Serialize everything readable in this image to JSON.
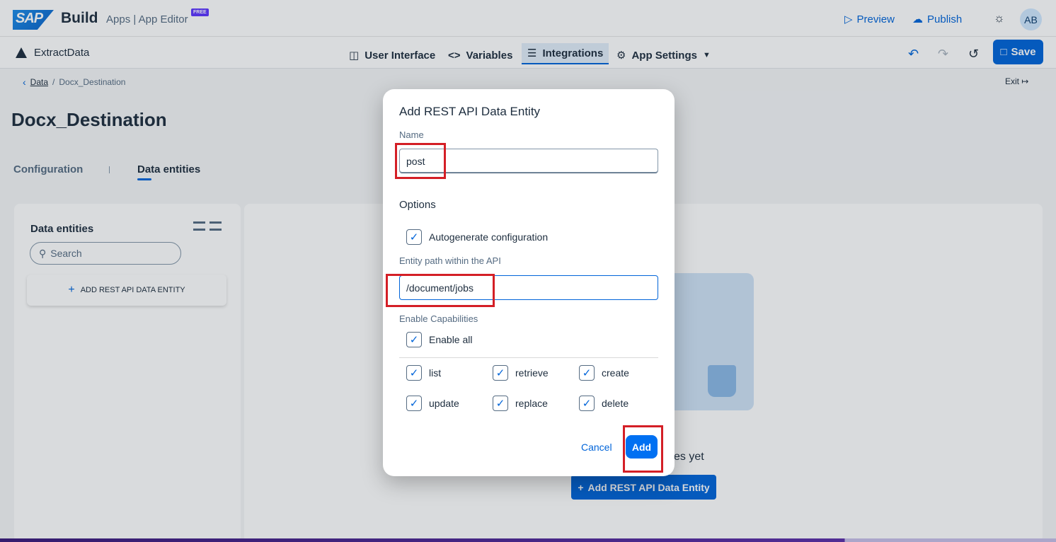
{
  "shell": {
    "brand": "Build",
    "brand_sub": "Apps  |  App Editor",
    "badge": "FREE",
    "preview": "Preview",
    "publish": "Publish",
    "avatar": "AB",
    "logo": "SAP"
  },
  "editor": {
    "app_name": "ExtractData",
    "tabs": [
      {
        "label": "User Interface",
        "icon": "monitor-icon"
      },
      {
        "label": "Variables",
        "icon": "code-icon"
      },
      {
        "label": "Integrations",
        "icon": "database-icon"
      },
      {
        "label": "App Settings",
        "icon": "gear-icon"
      }
    ],
    "save": "Save"
  },
  "breadcrumb": {
    "link": "Data",
    "separator": "/",
    "current": "Docx_Destination",
    "exit": "Exit"
  },
  "page": {
    "title": "Docx_Destination",
    "tabs": [
      "Configuration",
      "Data entities"
    ]
  },
  "left_panel": {
    "title": "Data entities",
    "search_placeholder": "Search",
    "add_button": "ADD REST API DATA ENTITY"
  },
  "right_panel": {
    "empty_text": "es yet",
    "add_button": "Add REST API Data Entity"
  },
  "dialog": {
    "title": "Add REST API Data Entity",
    "name_label": "Name",
    "name_value": "post",
    "options_label": "Options",
    "autogen_label": "Autogenerate configuration",
    "path_label": "Entity path within the API",
    "path_value": "/document/jobs",
    "capabilities_label": "Enable Capabilities",
    "enable_all_label": "Enable all",
    "capabilities": [
      "list",
      "retrieve",
      "create",
      "update",
      "replace",
      "delete"
    ],
    "cancel": "Cancel",
    "add": "Add"
  },
  "colors": {
    "accent": "#0064d9",
    "highlight": "#d41f26"
  }
}
